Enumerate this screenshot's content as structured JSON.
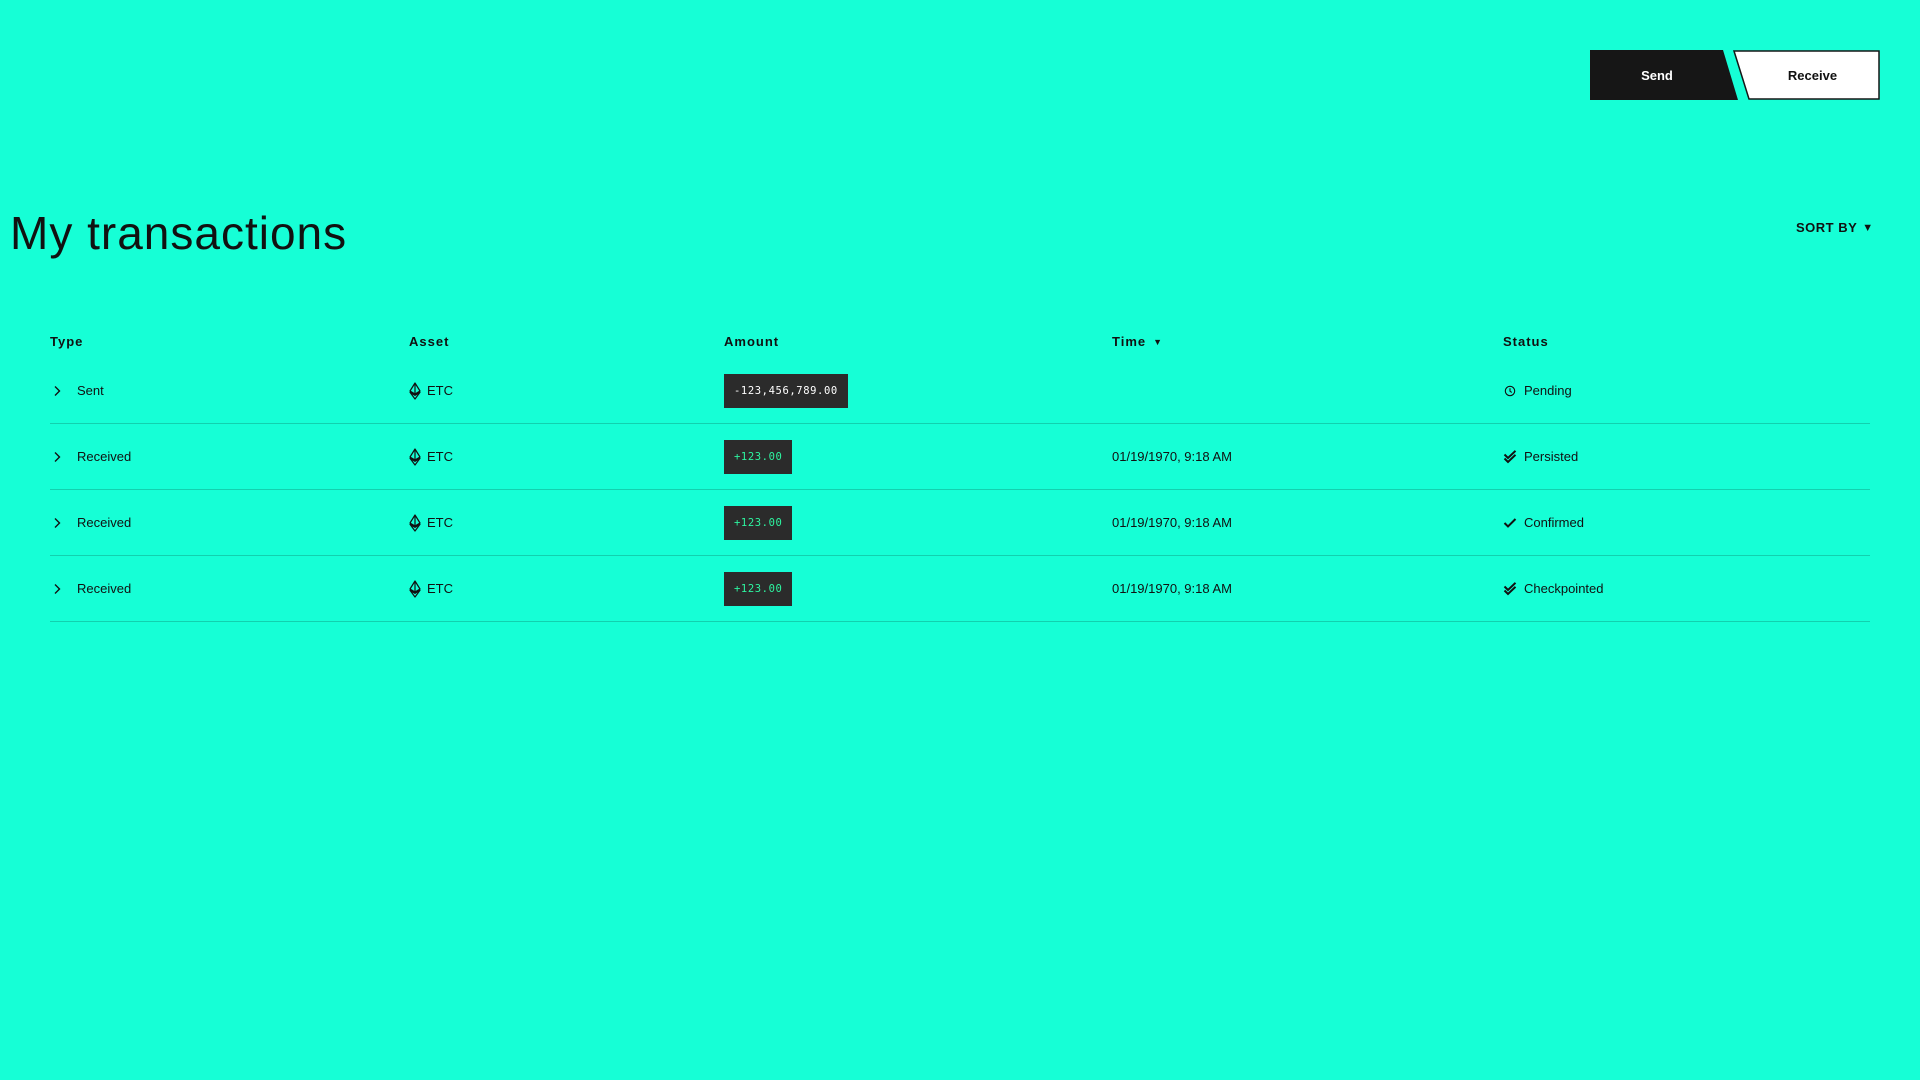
{
  "header": {
    "send_label": "Send",
    "receive_label": "Receive"
  },
  "page": {
    "title": "My transactions",
    "sort_by_label": "SORT BY",
    "sort_caret": "▼"
  },
  "table": {
    "columns": {
      "type": "Type",
      "asset": "Asset",
      "amount": "Amount",
      "time": "Time",
      "status": "Status"
    },
    "time_sort_caret": "▼",
    "rows": [
      {
        "type": "Sent",
        "asset": "ETC",
        "amount": "-123,456,789.00",
        "time": "",
        "status": "Pending",
        "status_icon": "clock-icon"
      },
      {
        "type": "Received",
        "asset": "ETC",
        "amount": "+123.00",
        "time": "01/19/1970, 9:18 AM",
        "status": "Persisted",
        "status_icon": "double-check-icon"
      },
      {
        "type": "Received",
        "asset": "ETC",
        "amount": "+123.00",
        "time": "01/19/1970, 9:18 AM",
        "status": "Confirmed",
        "status_icon": "check-icon"
      },
      {
        "type": "Received",
        "asset": "ETC",
        "amount": "+123.00",
        "time": "01/19/1970, 9:18 AM",
        "status": "Checkpointed",
        "status_icon": "double-check-icon"
      }
    ]
  },
  "colors": {
    "background": "#16ffd6",
    "dark": "#161616",
    "badge_bg": "#2b2b2b",
    "negative_amount": "#ffffff",
    "positive_amount": "#2df5a0"
  }
}
